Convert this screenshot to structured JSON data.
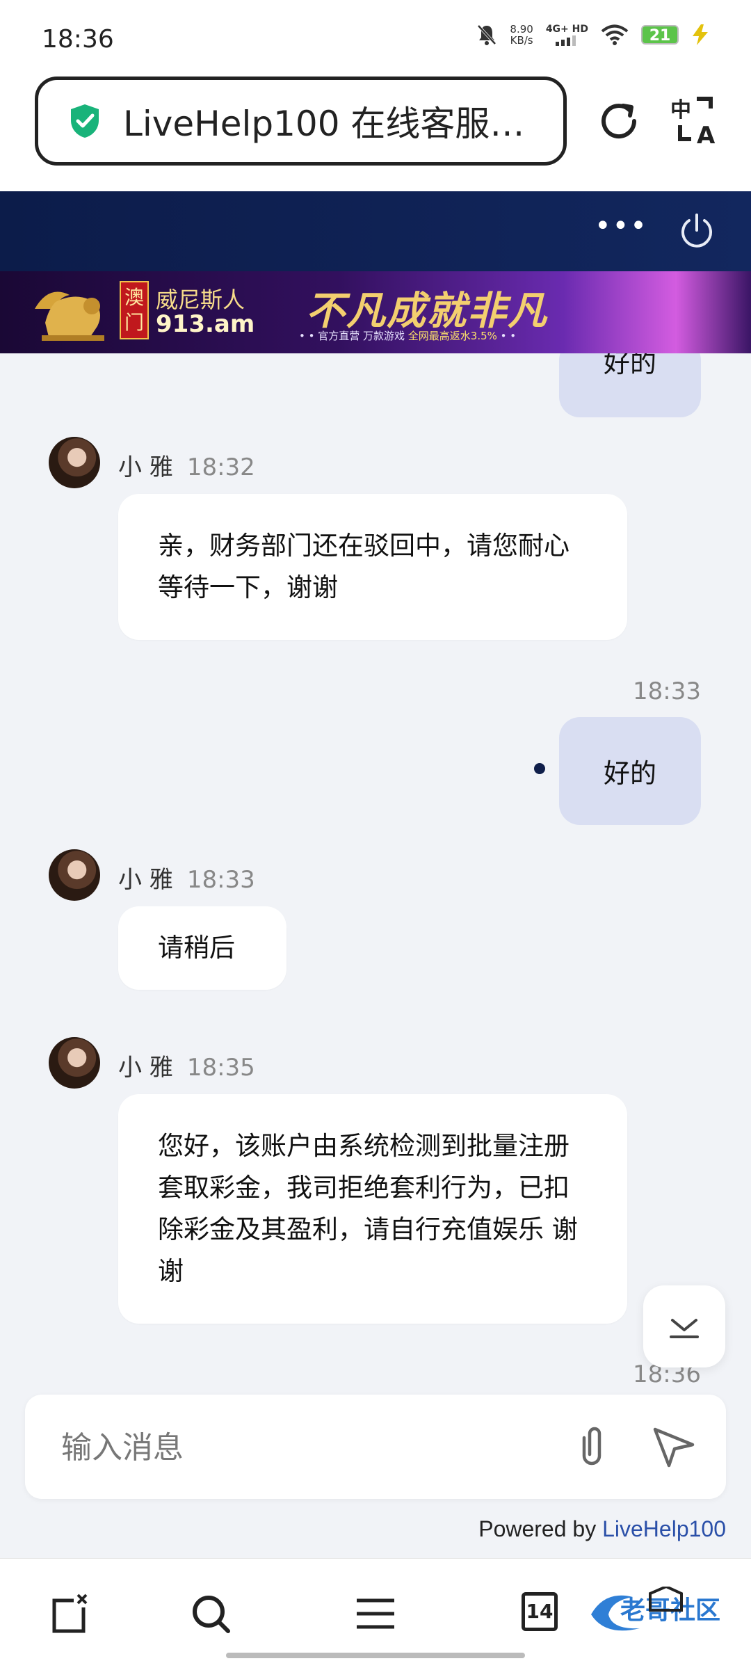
{
  "status_bar": {
    "time": "18:36",
    "speed": "8.90",
    "speed_unit": "KB/s",
    "network": "4G+ HD",
    "battery": "21"
  },
  "browser": {
    "url_title": "LiveHelp100 在线客服…"
  },
  "banner": {
    "logo_macau": [
      "澳",
      "门"
    ],
    "brand_name": "威尼斯人",
    "brand_domain": "913.am",
    "slogan": "不凡成就非凡",
    "sub_text": "• • 官方直营  万款游戏 ",
    "sub_highlight": "全网最高返水3.5%",
    "sub_end": " • •"
  },
  "chat": {
    "messages": [
      {
        "dir": "out",
        "text": "好的"
      },
      {
        "dir": "in",
        "sender": "小 雅",
        "time": "18:32",
        "text": "亲，财务部门还在驳回中，请您耐心等待一下，谢谢"
      },
      {
        "dir": "out",
        "time": "18:33",
        "text": "好的"
      },
      {
        "dir": "in",
        "sender": "小 雅",
        "time": "18:33",
        "text": "请稍后"
      },
      {
        "dir": "in",
        "sender": "小 雅",
        "time": "18:35",
        "text": "您好，该账户由系统检测到批量注册套取彩金，我司拒绝套利行为，已扣除彩金及其盈利，请自行充值娱乐 谢谢"
      }
    ],
    "last_time": "18:36"
  },
  "input": {
    "placeholder": "输入消息"
  },
  "footer": {
    "powered_prefix": "Powered by ",
    "powered_brand": "LiveHelp100"
  },
  "nav": {
    "tab_count": "14"
  },
  "watermark_text": "老哥社区",
  "colors": {
    "header": "#0c1c4a",
    "bubble_out": "#d9def2",
    "bubble_in": "#ffffff",
    "bg": "#f1f3f7"
  }
}
